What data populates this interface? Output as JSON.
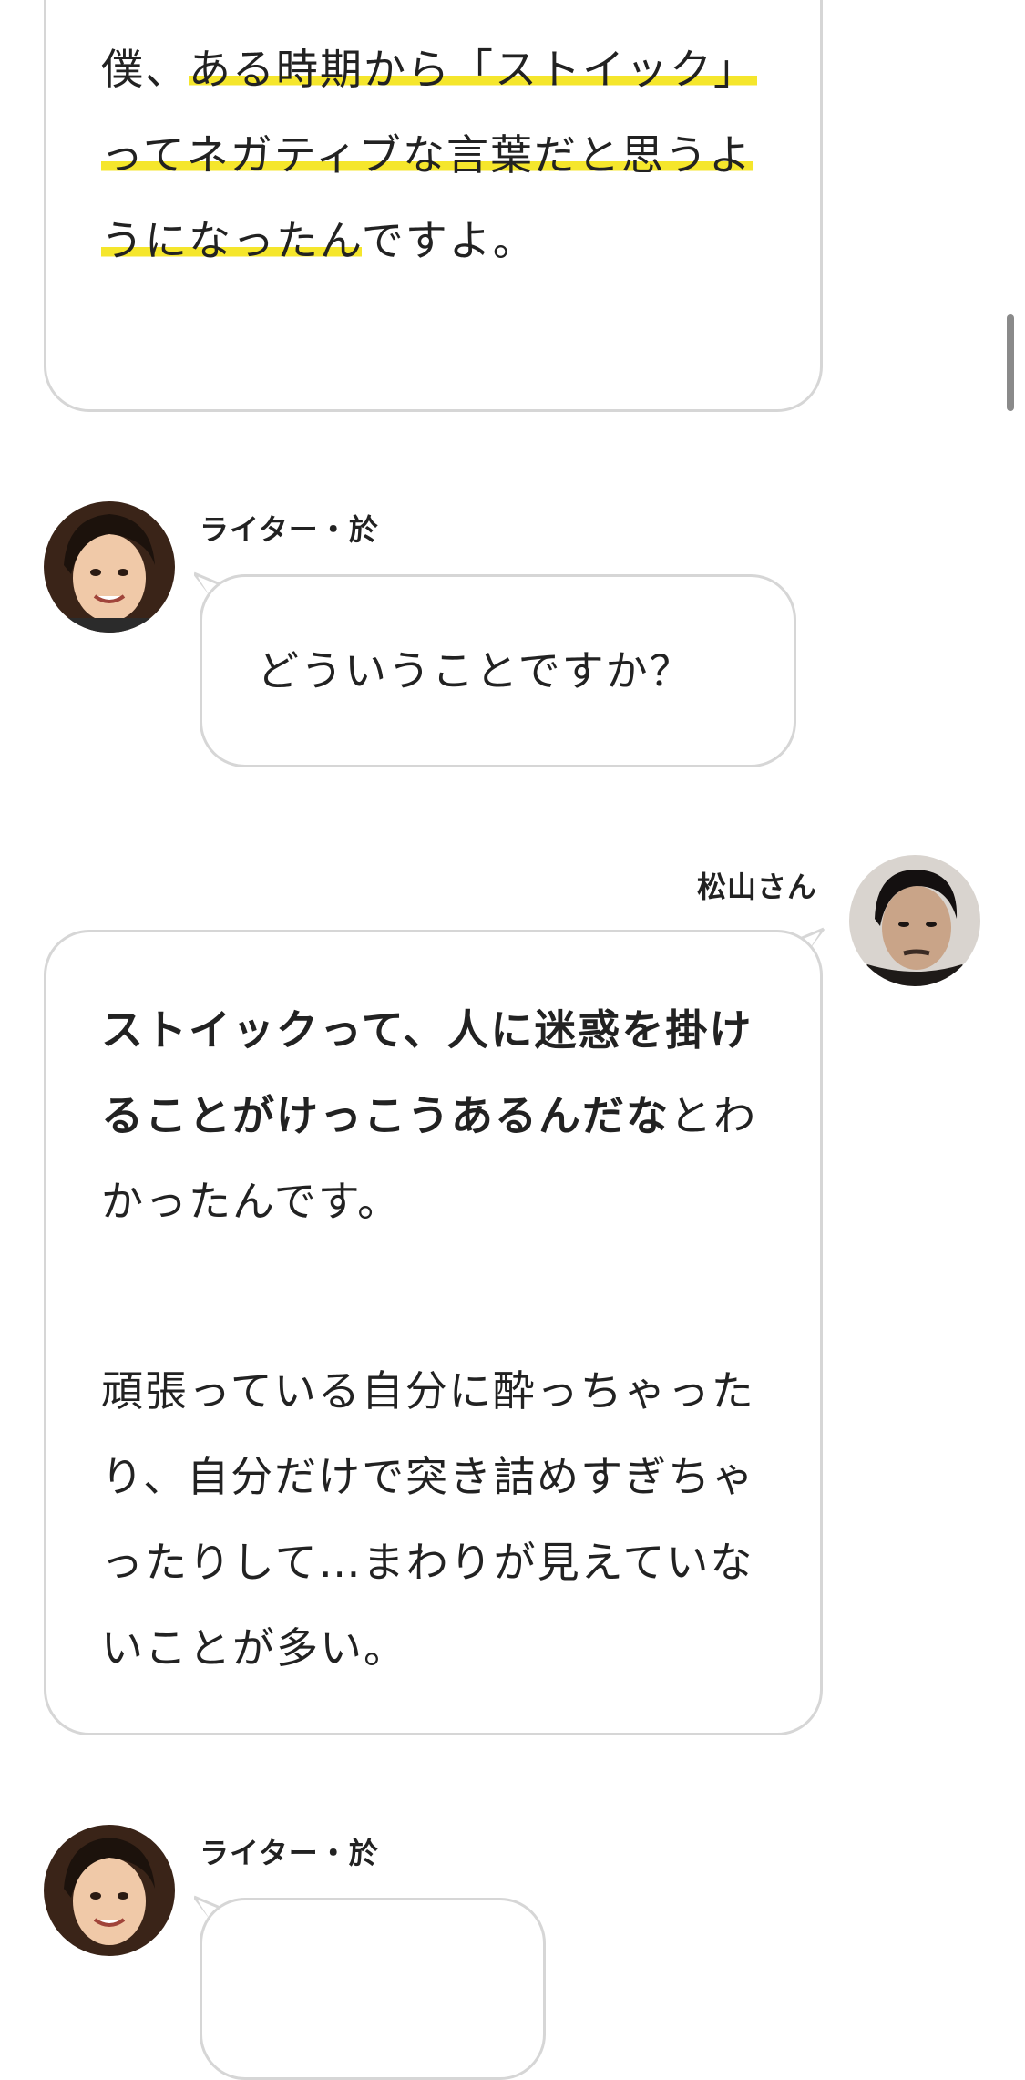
{
  "bubble1": {
    "line1_plain": "僕、",
    "line1_hl": "ある時期から「ストイッ",
    "line2_hl": "ク」ってネガティブな言葉だ",
    "line3_hl": "と思うようになったん",
    "line3_rest": "ですよ。"
  },
  "writer1": {
    "name": "ライター・於",
    "message": "どういうことですか？",
    "avatar_icon": "woman-portrait-avatar"
  },
  "matsuyama": {
    "name": "松山さん",
    "avatar_icon": "man-portrait-avatar",
    "bold_part": "ストイックって、人に迷惑を掛けることがけっこうあるんだな",
    "rest_part": "とわかったんです。",
    "para2": "頑張っている自分に酔っちゃったり、自分だけで突き詰めすぎちゃったりして…まわりが見えていないことが多い。"
  },
  "writer2": {
    "name": "ライター・於",
    "avatar_icon": "woman-portrait-avatar"
  },
  "colors": {
    "highlight": "#f5e62c",
    "bubble_border": "#d6d6d6",
    "text": "#222222"
  }
}
